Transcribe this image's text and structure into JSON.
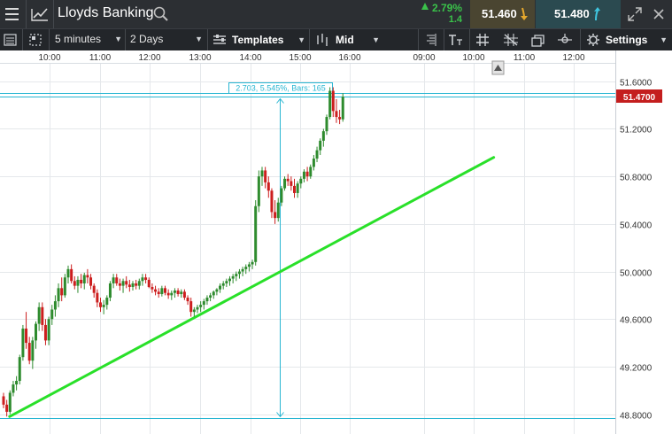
{
  "header": {
    "instrument": "Lloyds Banking",
    "change_pct": "2.79%",
    "change_abs": "1.4",
    "sell_price": "51.460",
    "buy_price": "51.480"
  },
  "toolbar": {
    "interval": "5 minutes",
    "range": "2 Days",
    "templates_label": "Templates",
    "price_type": "Mid",
    "settings_label": "Settings"
  },
  "colors": {
    "up": "#2e8b2e",
    "down": "#cc1e1e",
    "trendline": "#29e029",
    "measure": "#29b6d2",
    "price_badge": "#c41e1e"
  },
  "measurement": {
    "label": "2.703, 5.545%, Bars: 165"
  },
  "current_price": "51.4700",
  "chart_data": {
    "type": "candlestick",
    "x_tick_labels": [
      "10:00",
      "11:00",
      "12:00",
      "13:00",
      "14:00",
      "15:00",
      "16:00",
      "09:00",
      "10:00",
      "11:00",
      "12:00"
    ],
    "y_tick_labels": [
      "51.6000",
      "51.2000",
      "50.8000",
      "50.4000",
      "50.0000",
      "49.6000",
      "49.2000",
      "48.8000"
    ],
    "y_ticks": [
      51.6,
      51.2,
      50.8,
      50.4,
      50.0,
      49.6,
      49.2,
      48.8
    ],
    "ylim": [
      48.73,
      51.74
    ],
    "grid": true,
    "current_price": 51.47,
    "candles": [
      [
        48.95,
        48.98,
        48.85,
        48.88
      ],
      [
        48.88,
        48.92,
        48.78,
        48.82
      ],
      [
        48.82,
        49.0,
        48.8,
        48.98
      ],
      [
        48.98,
        49.08,
        48.95,
        49.05
      ],
      [
        49.05,
        49.12,
        49.0,
        49.08
      ],
      [
        49.08,
        49.3,
        49.05,
        49.28
      ],
      [
        49.28,
        49.55,
        49.25,
        49.52
      ],
      [
        49.52,
        49.66,
        49.35,
        49.4
      ],
      [
        49.4,
        49.45,
        49.22,
        49.25
      ],
      [
        49.25,
        49.45,
        49.18,
        49.42
      ],
      [
        49.42,
        49.58,
        49.35,
        49.56
      ],
      [
        49.56,
        49.74,
        49.5,
        49.7
      ],
      [
        49.7,
        49.74,
        49.5,
        49.55
      ],
      [
        49.55,
        49.6,
        49.38,
        49.42
      ],
      [
        49.42,
        49.62,
        49.38,
        49.6
      ],
      [
        49.6,
        49.72,
        49.55,
        49.68
      ],
      [
        49.68,
        49.8,
        49.62,
        49.75
      ],
      [
        49.75,
        49.9,
        49.7,
        49.86
      ],
      [
        49.86,
        49.95,
        49.75,
        49.8
      ],
      [
        49.8,
        49.98,
        49.78,
        49.95
      ],
      [
        49.95,
        50.05,
        49.9,
        50.02
      ],
      [
        50.02,
        50.06,
        49.9,
        49.92
      ],
      [
        49.92,
        49.96,
        49.85,
        49.88
      ],
      [
        49.88,
        49.96,
        49.82,
        49.93
      ],
      [
        49.93,
        49.98,
        49.86,
        49.9
      ],
      [
        49.9,
        49.99,
        49.85,
        49.97
      ],
      [
        49.97,
        50.02,
        49.9,
        49.95
      ],
      [
        49.95,
        49.98,
        49.85,
        49.88
      ],
      [
        49.88,
        49.9,
        49.78,
        49.82
      ],
      [
        49.82,
        49.85,
        49.7,
        49.74
      ],
      [
        49.74,
        49.78,
        49.66,
        49.7
      ],
      [
        49.7,
        49.76,
        49.64,
        49.72
      ],
      [
        49.72,
        49.8,
        49.68,
        49.78
      ],
      [
        49.78,
        49.92,
        49.75,
        49.9
      ],
      [
        49.9,
        49.98,
        49.86,
        49.95
      ],
      [
        49.95,
        49.98,
        49.88,
        49.9
      ],
      [
        49.9,
        49.94,
        49.84,
        49.88
      ],
      [
        49.88,
        49.94,
        49.82,
        49.92
      ],
      [
        49.92,
        49.96,
        49.86,
        49.89
      ],
      [
        49.89,
        49.93,
        49.83,
        49.87
      ],
      [
        49.87,
        49.92,
        49.84,
        49.9
      ],
      [
        49.9,
        49.93,
        49.85,
        49.88
      ],
      [
        49.88,
        49.94,
        49.85,
        49.92
      ],
      [
        49.92,
        49.98,
        49.88,
        49.95
      ],
      [
        49.95,
        49.98,
        49.9,
        49.93
      ],
      [
        49.93,
        49.95,
        49.86,
        49.87
      ],
      [
        49.87,
        49.9,
        49.82,
        49.85
      ],
      [
        49.85,
        49.88,
        49.8,
        49.83
      ],
      [
        49.83,
        49.86,
        49.78,
        49.81
      ],
      [
        49.81,
        49.88,
        49.79,
        49.86
      ],
      [
        49.86,
        49.88,
        49.8,
        49.82
      ],
      [
        49.82,
        49.85,
        49.77,
        49.8
      ],
      [
        49.8,
        49.84,
        49.76,
        49.82
      ],
      [
        49.82,
        49.86,
        49.78,
        49.84
      ],
      [
        49.84,
        49.86,
        49.79,
        49.81
      ],
      [
        49.81,
        49.85,
        49.78,
        49.83
      ],
      [
        49.83,
        49.85,
        49.76,
        49.78
      ],
      [
        49.78,
        49.8,
        49.72,
        49.75
      ],
      [
        49.75,
        49.78,
        49.62,
        49.66
      ],
      [
        49.66,
        49.7,
        49.62,
        49.68
      ],
      [
        49.68,
        49.72,
        49.65,
        49.7
      ],
      [
        49.7,
        49.75,
        49.66,
        49.72
      ],
      [
        49.72,
        49.77,
        49.68,
        49.75
      ],
      [
        49.75,
        49.8,
        49.72,
        49.78
      ],
      [
        49.78,
        49.82,
        49.75,
        49.8
      ],
      [
        49.8,
        49.84,
        49.77,
        49.83
      ],
      [
        49.83,
        49.86,
        49.8,
        49.85
      ],
      [
        49.85,
        49.9,
        49.82,
        49.88
      ],
      [
        49.88,
        49.92,
        49.85,
        49.9
      ],
      [
        49.9,
        49.94,
        49.87,
        49.92
      ],
      [
        49.92,
        49.96,
        49.88,
        49.94
      ],
      [
        49.94,
        49.98,
        49.9,
        49.96
      ],
      [
        49.96,
        50.0,
        49.92,
        49.98
      ],
      [
        49.98,
        50.02,
        49.94,
        50.0
      ],
      [
        50.0,
        50.04,
        49.96,
        50.02
      ],
      [
        50.02,
        50.06,
        49.98,
        50.04
      ],
      [
        50.04,
        50.08,
        50.0,
        50.06
      ],
      [
        50.06,
        50.1,
        50.02,
        50.08
      ],
      [
        50.08,
        50.6,
        50.05,
        50.55
      ],
      [
        50.55,
        50.85,
        50.5,
        50.8
      ],
      [
        50.8,
        50.88,
        50.72,
        50.85
      ],
      [
        50.85,
        50.88,
        50.7,
        50.75
      ],
      [
        50.75,
        50.8,
        50.62,
        50.68
      ],
      [
        50.68,
        50.7,
        50.45,
        50.5
      ],
      [
        50.5,
        50.6,
        50.4,
        50.45
      ],
      [
        50.45,
        50.62,
        50.42,
        50.58
      ],
      [
        50.58,
        50.72,
        50.55,
        50.7
      ],
      [
        50.7,
        50.8,
        50.68,
        50.78
      ],
      [
        50.78,
        50.82,
        50.72,
        50.76
      ],
      [
        50.76,
        50.8,
        50.68,
        50.72
      ],
      [
        50.72,
        50.78,
        50.62,
        50.66
      ],
      [
        50.66,
        50.76,
        50.62,
        50.74
      ],
      [
        50.74,
        50.8,
        50.7,
        50.78
      ],
      [
        50.78,
        50.86,
        50.75,
        50.84
      ],
      [
        50.84,
        50.88,
        50.76,
        50.8
      ],
      [
        50.8,
        50.9,
        50.78,
        50.88
      ],
      [
        50.88,
        50.98,
        50.85,
        50.95
      ],
      [
        50.95,
        51.05,
        50.92,
        51.02
      ],
      [
        51.02,
        51.12,
        50.98,
        51.1
      ],
      [
        51.1,
        51.2,
        51.05,
        51.18
      ],
      [
        51.18,
        51.32,
        51.15,
        51.3
      ],
      [
        51.3,
        51.55,
        51.28,
        51.52
      ],
      [
        51.52,
        51.55,
        51.3,
        51.35
      ],
      [
        51.35,
        51.45,
        51.25,
        51.3
      ],
      [
        51.3,
        51.36,
        51.24,
        51.28
      ],
      [
        51.28,
        51.5,
        51.26,
        51.47
      ]
    ],
    "measure": {
      "from": 48.767,
      "to": 51.47
    },
    "trendline": {
      "from_bar": 2,
      "from_price": 48.78,
      "to_bar": 151.0,
      "to_price": 50.96
    }
  }
}
